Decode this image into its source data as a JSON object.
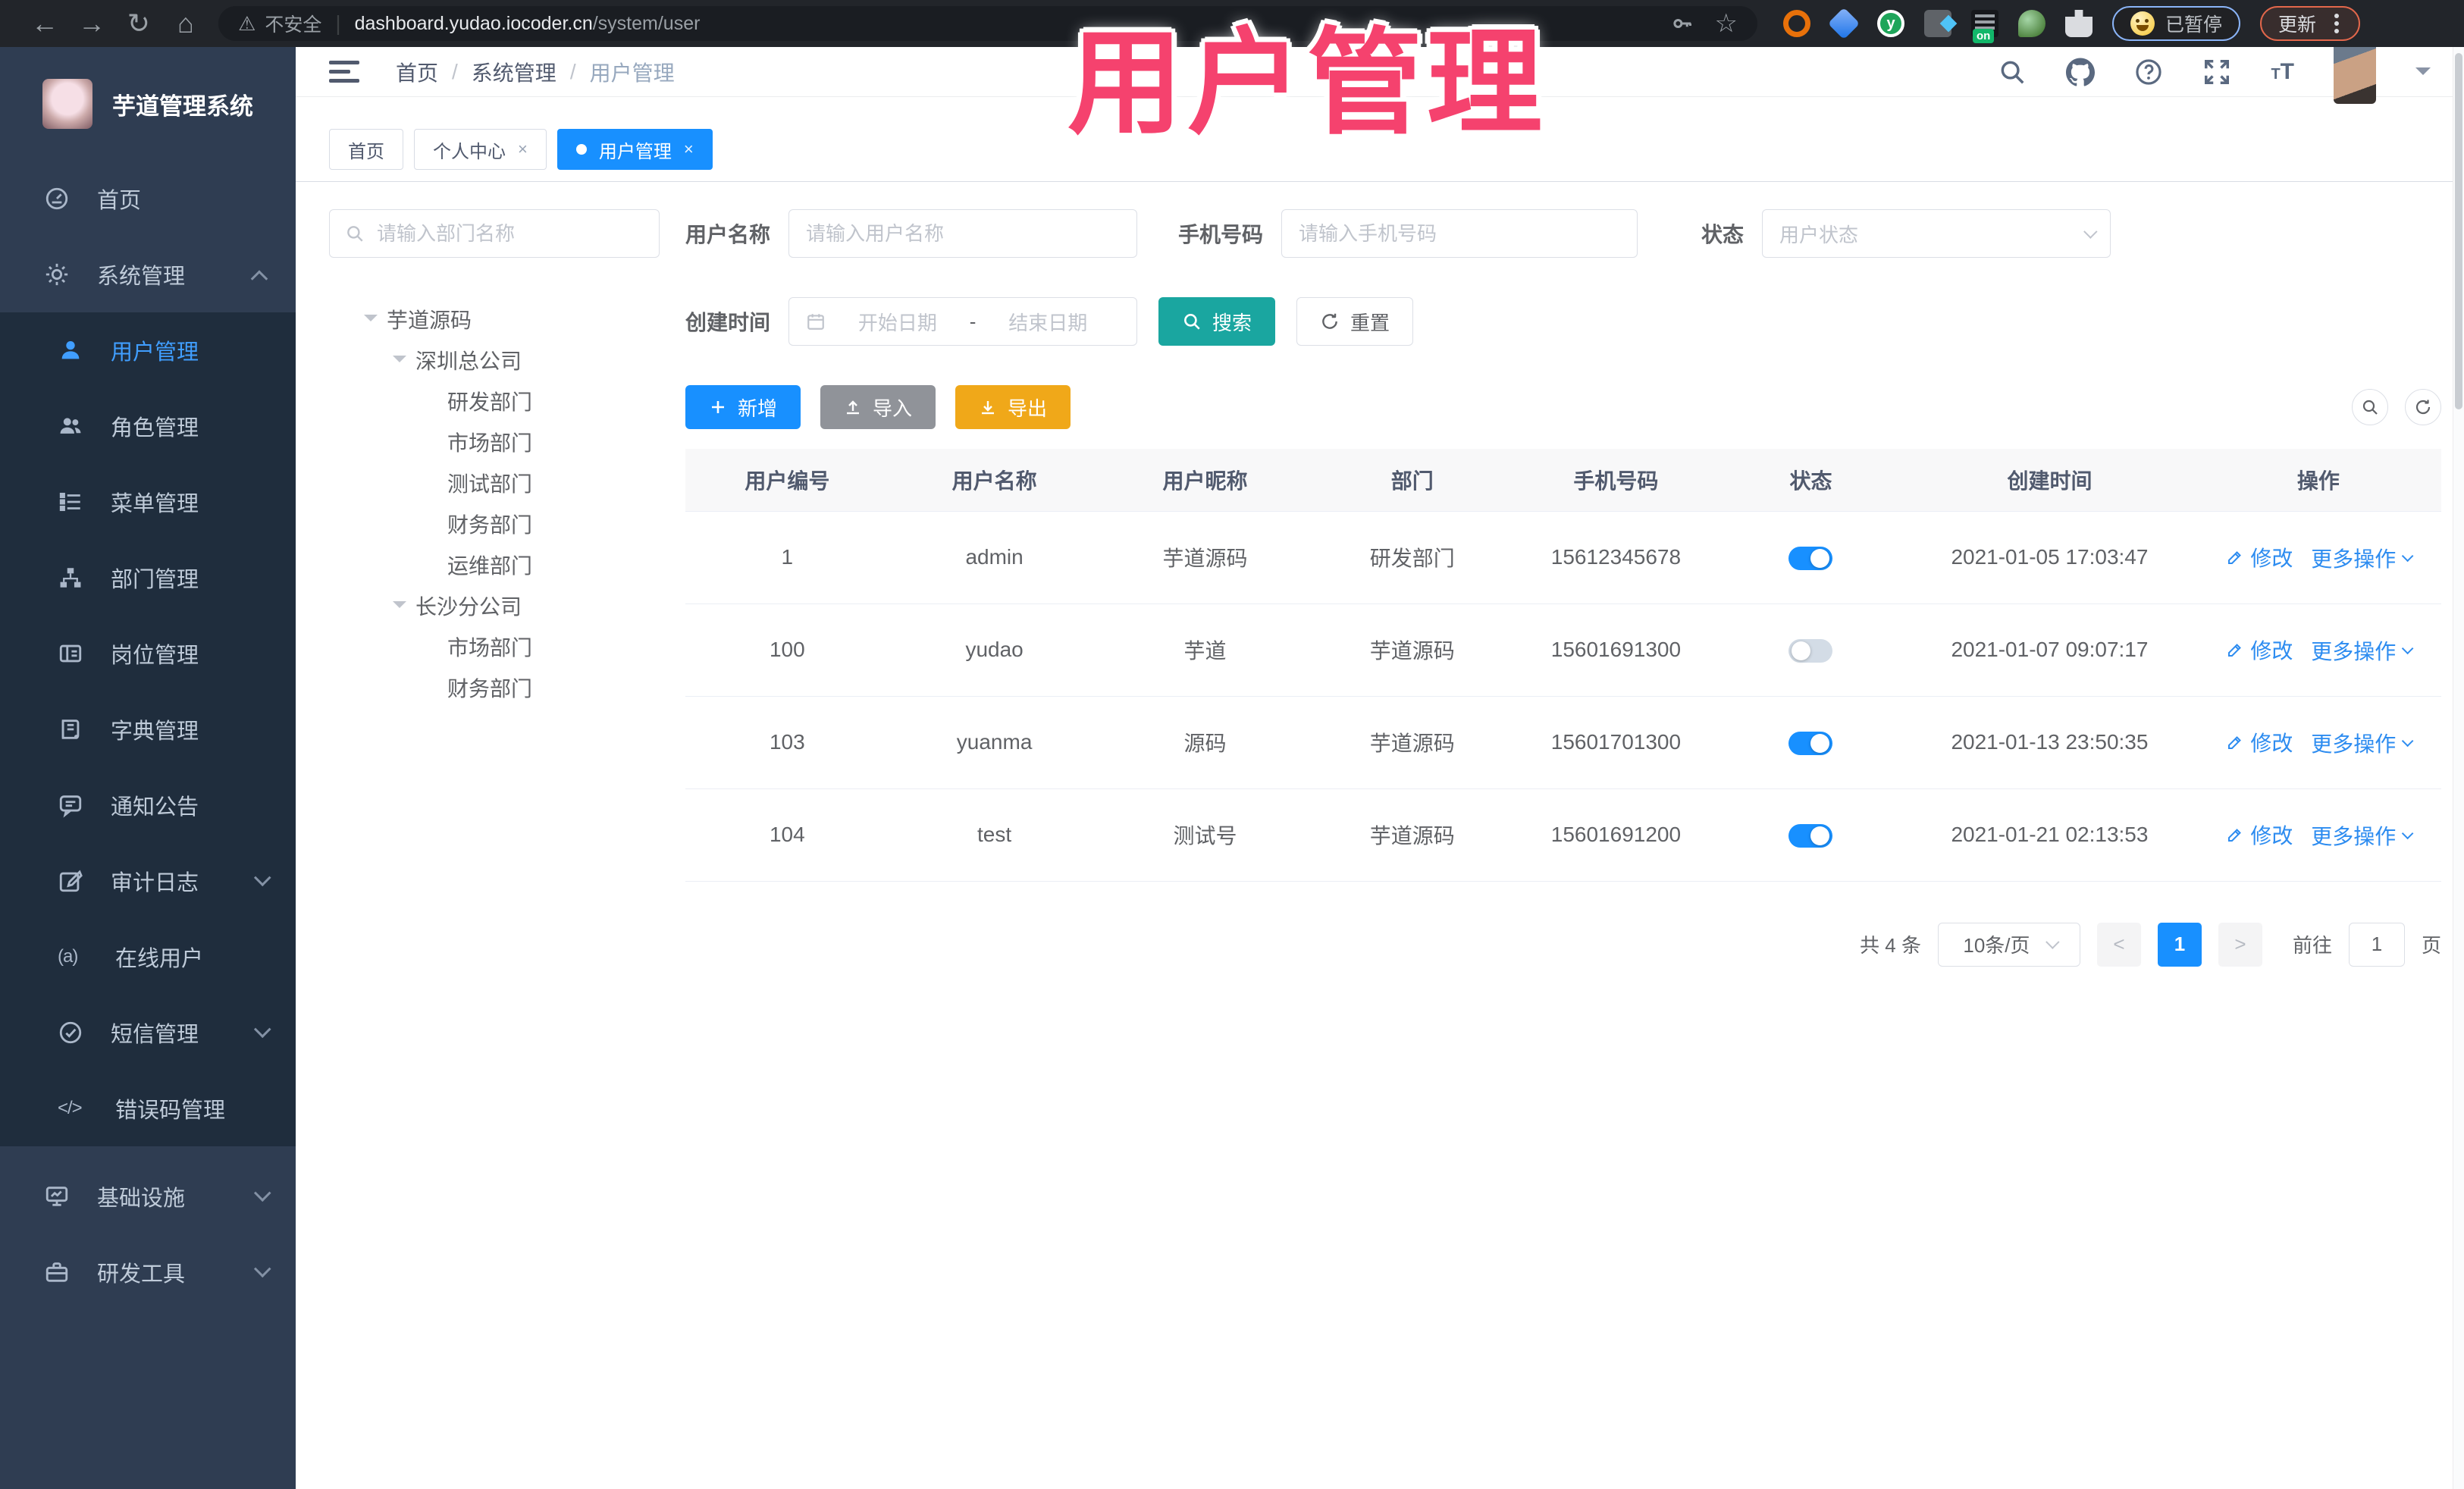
{
  "overlay": {
    "title": "用户管理"
  },
  "browser": {
    "security_label": "不安全",
    "url_host": "dashboard.yudao.iocoder.cn",
    "url_path": "/system/user",
    "extension_on_badge": "on",
    "paused_badge": "已暂停",
    "update_button": "更新"
  },
  "topbar": {
    "breadcrumb": [
      "首页",
      "系统管理",
      "用户管理"
    ],
    "breadcrumb_separator": "/"
  },
  "tabs": [
    {
      "label": "首页"
    },
    {
      "label": "个人中心",
      "close": "×"
    },
    {
      "label": "用户管理",
      "close": "×"
    }
  ],
  "sidebar": {
    "logo_title": "芋道管理系统",
    "items": [
      {
        "label": "首页"
      },
      {
        "label": "系统管理"
      }
    ],
    "submenu": [
      {
        "label": "用户管理"
      },
      {
        "label": "角色管理"
      },
      {
        "label": "菜单管理"
      },
      {
        "label": "部门管理"
      },
      {
        "label": "岗位管理"
      },
      {
        "label": "字典管理"
      },
      {
        "label": "通知公告"
      },
      {
        "label": "审计日志"
      },
      {
        "label": "在线用户"
      },
      {
        "label": "短信管理"
      },
      {
        "label": "错误码管理"
      }
    ],
    "bottom": [
      {
        "label": "基础设施"
      },
      {
        "label": "研发工具"
      }
    ],
    "icon_glyphs": {
      "online": "(a)",
      "code": "</>"
    }
  },
  "tree": {
    "search_placeholder": "请输入部门名称",
    "nodes": [
      {
        "label": "芋道源码"
      },
      {
        "label": "深圳总公司"
      },
      {
        "label": "研发部门"
      },
      {
        "label": "市场部门"
      },
      {
        "label": "测试部门"
      },
      {
        "label": "财务部门"
      },
      {
        "label": "运维部门"
      },
      {
        "label": "长沙分公司"
      },
      {
        "label": "市场部门"
      },
      {
        "label": "财务部门"
      }
    ]
  },
  "filters": {
    "username_label": "用户名称",
    "username_placeholder": "请输入用户名称",
    "mobile_label": "手机号码",
    "mobile_placeholder": "请输入手机号码",
    "status_label": "状态",
    "status_placeholder": "用户状态",
    "created_label": "创建时间",
    "date_start_placeholder": "开始日期",
    "date_separator": "-",
    "date_end_placeholder": "结束日期",
    "search_button": "搜索",
    "reset_button": "重置"
  },
  "toolbar": {
    "add": "新增",
    "import": "导入",
    "export": "导出"
  },
  "table": {
    "columns": [
      "用户编号",
      "用户名称",
      "用户昵称",
      "部门",
      "手机号码",
      "状态",
      "创建时间",
      "操作"
    ],
    "edit_label": "修改",
    "more_label": "更多操作",
    "rows": [
      {
        "id": "1",
        "username": "admin",
        "nickname": "芋道源码",
        "dept": "研发部门",
        "mobile": "15612345678",
        "status_on": true,
        "created": "2021-01-05 17:03:47"
      },
      {
        "id": "100",
        "username": "yudao",
        "nickname": "芋道",
        "dept": "芋道源码",
        "mobile": "15601691300",
        "status_on": false,
        "created": "2021-01-07 09:07:17"
      },
      {
        "id": "103",
        "username": "yuanma",
        "nickname": "源码",
        "dept": "芋道源码",
        "mobile": "15601701300",
        "status_on": true,
        "created": "2021-01-13 23:50:35"
      },
      {
        "id": "104",
        "username": "test",
        "nickname": "测试号",
        "dept": "芋道源码",
        "mobile": "15601691200",
        "status_on": true,
        "created": "2021-01-21 02:13:53"
      }
    ]
  },
  "pagination": {
    "total": "共 4 条",
    "page_size": "10条/页",
    "prev": "<",
    "page": "1",
    "next": ">",
    "goto_label": "前往",
    "goto_value": "1",
    "page_unit": "页"
  },
  "colors": {
    "accent_blue": "#1890ff",
    "link_blue": "#2d8cf0",
    "sidebar_active": "#409eff",
    "teal": "#1aa6a0",
    "warning_yellow": "#f0a819",
    "gray_button": "#909399",
    "overlay_pink": "#f5426e",
    "sidebar_bg": "#2f3d52",
    "submenu_bg": "#1f2d3d"
  }
}
